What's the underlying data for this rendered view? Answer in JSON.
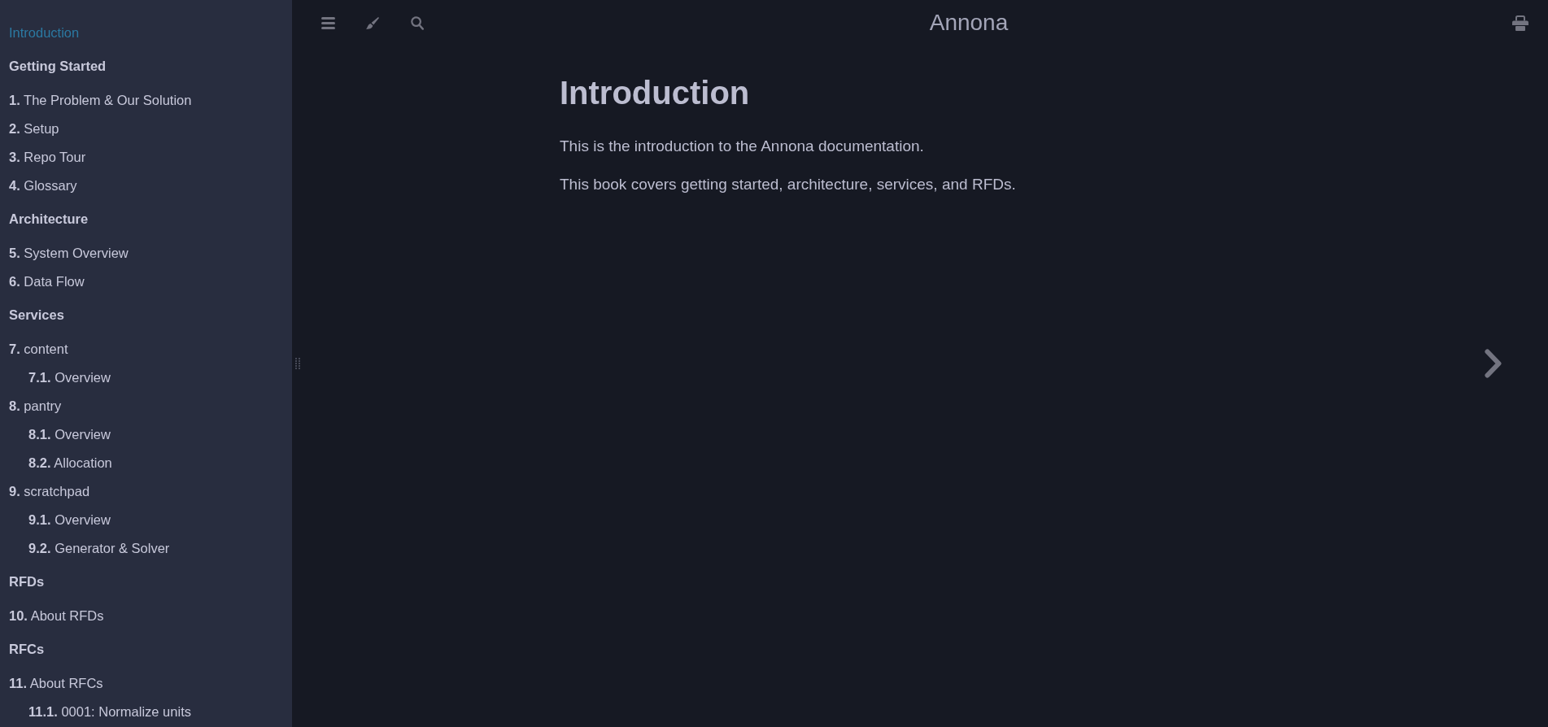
{
  "menu_bar": {
    "title": "Annona"
  },
  "sidebar": {
    "items": [
      {
        "kind": "chapter",
        "title": "Introduction",
        "selected": true
      },
      {
        "kind": "part_title",
        "title": "Getting Started"
      },
      {
        "kind": "chapter",
        "number": "1.",
        "title": "The Problem & Our Solution",
        "selected": false
      },
      {
        "kind": "chapter",
        "number": "2.",
        "title": "Setup",
        "selected": false
      },
      {
        "kind": "chapter",
        "number": "3.",
        "title": "Repo Tour",
        "selected": false
      },
      {
        "kind": "chapter",
        "number": "4.",
        "title": "Glossary",
        "selected": false
      },
      {
        "kind": "part_title",
        "title": "Architecture"
      },
      {
        "kind": "chapter",
        "number": "5.",
        "title": "System Overview",
        "selected": false
      },
      {
        "kind": "chapter",
        "number": "6.",
        "title": "Data Flow",
        "selected": false
      },
      {
        "kind": "part_title",
        "title": "Services"
      },
      {
        "kind": "chapter",
        "number": "7.",
        "title": "content",
        "selected": false,
        "children": [
          {
            "kind": "chapter",
            "number": "7.1.",
            "title": "Overview",
            "selected": false
          }
        ]
      },
      {
        "kind": "chapter",
        "number": "8.",
        "title": "pantry",
        "selected": false,
        "children": [
          {
            "kind": "chapter",
            "number": "8.1.",
            "title": "Overview",
            "selected": false
          },
          {
            "kind": "chapter",
            "number": "8.2.",
            "title": "Allocation",
            "selected": false
          }
        ]
      },
      {
        "kind": "chapter",
        "number": "9.",
        "title": "scratchpad",
        "selected": false,
        "children": [
          {
            "kind": "chapter",
            "number": "9.1.",
            "title": "Overview",
            "selected": false
          },
          {
            "kind": "chapter",
            "number": "9.2.",
            "title": "Generator & Solver",
            "selected": false
          }
        ]
      },
      {
        "kind": "part_title",
        "title": "RFDs"
      },
      {
        "kind": "chapter",
        "number": "10.",
        "title": "About RFDs",
        "selected": false
      },
      {
        "kind": "part_title",
        "title": "RFCs"
      },
      {
        "kind": "chapter",
        "number": "11.",
        "title": "About RFCs",
        "selected": false,
        "children": [
          {
            "kind": "chapter",
            "number": "11.1.",
            "title": "0001: Normalize units",
            "selected": false
          }
        ]
      }
    ]
  },
  "content": {
    "heading": "Introduction",
    "paragraphs": [
      "This is the introduction to the Annona documentation.",
      "This book covers getting started, architecture, services, and RFDs."
    ]
  }
}
